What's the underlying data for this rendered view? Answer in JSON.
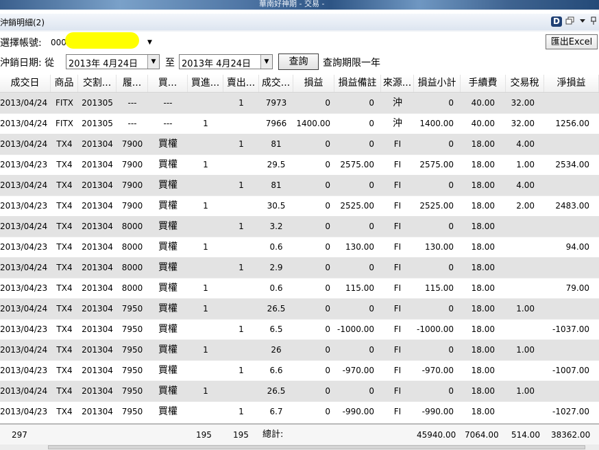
{
  "window": {
    "title_strip": "華南好神期 - 交易 -"
  },
  "panel": {
    "title": "沖銷明細(2)",
    "icons": [
      "d-logo-icon",
      "restore-window-icon",
      "dropdown-arrow-icon",
      "pin-icon"
    ]
  },
  "toolbar": {
    "account_label": "選擇帳號:",
    "account_value": "000",
    "excel_button": "匯出Excel",
    "date_label": "沖銷日期: 從",
    "from_date": "2013年  4月24日",
    "to_label": "至",
    "to_date": "2013年  4月24日",
    "query_button": "查詢",
    "query_note": "查詢期限一年"
  },
  "table": {
    "columns": [
      "成交日",
      "商品",
      "交割...",
      "履...",
      "買...",
      "買進...",
      "賣出...",
      "成交...",
      "損益",
      "損益備註",
      "來源...",
      "損益小計",
      "手續費",
      "交易稅",
      "淨損益"
    ],
    "rows": [
      [
        "2013/04/24",
        "FITX",
        "201305",
        "---",
        "---",
        "",
        "1",
        "7973",
        "0",
        "0",
        "沖",
        "0",
        "40.00",
        "32.00",
        ""
      ],
      [
        "2013/04/24",
        "FITX",
        "201305",
        "---",
        "---",
        "1",
        "",
        "7966",
        "1400.00",
        "0",
        "沖",
        "1400.00",
        "40.00",
        "32.00",
        "1256.00"
      ],
      [
        "2013/04/24",
        "TX4",
        "201304",
        "7900",
        "買權",
        "",
        "1",
        "81",
        "0",
        "0",
        "FI",
        "0",
        "18.00",
        "4.00",
        ""
      ],
      [
        "2013/04/23",
        "TX4",
        "201304",
        "7900",
        "買權",
        "1",
        "",
        "29.5",
        "0",
        "2575.00",
        "FI",
        "2575.00",
        "18.00",
        "1.00",
        "2534.00"
      ],
      [
        "2013/04/24",
        "TX4",
        "201304",
        "7900",
        "買權",
        "",
        "1",
        "81",
        "0",
        "0",
        "FI",
        "0",
        "18.00",
        "4.00",
        ""
      ],
      [
        "2013/04/23",
        "TX4",
        "201304",
        "7900",
        "買權",
        "1",
        "",
        "30.5",
        "0",
        "2525.00",
        "FI",
        "2525.00",
        "18.00",
        "2.00",
        "2483.00"
      ],
      [
        "2013/04/24",
        "TX4",
        "201304",
        "8000",
        "買權",
        "",
        "1",
        "3.2",
        "0",
        "0",
        "FI",
        "0",
        "18.00",
        "",
        ""
      ],
      [
        "2013/04/23",
        "TX4",
        "201304",
        "8000",
        "買權",
        "1",
        "",
        "0.6",
        "0",
        "130.00",
        "FI",
        "130.00",
        "18.00",
        "",
        "94.00"
      ],
      [
        "2013/04/24",
        "TX4",
        "201304",
        "8000",
        "買權",
        "",
        "1",
        "2.9",
        "0",
        "0",
        "FI",
        "0",
        "18.00",
        "",
        ""
      ],
      [
        "2013/04/23",
        "TX4",
        "201304",
        "8000",
        "買權",
        "1",
        "",
        "0.6",
        "0",
        "115.00",
        "FI",
        "115.00",
        "18.00",
        "",
        "79.00"
      ],
      [
        "2013/04/24",
        "TX4",
        "201304",
        "7950",
        "買權",
        "1",
        "",
        "26.5",
        "0",
        "0",
        "FI",
        "0",
        "18.00",
        "1.00",
        ""
      ],
      [
        "2013/04/23",
        "TX4",
        "201304",
        "7950",
        "買權",
        "",
        "1",
        "6.5",
        "0",
        "-1000.00",
        "FI",
        "-1000.00",
        "18.00",
        "",
        "-1037.00"
      ],
      [
        "2013/04/24",
        "TX4",
        "201304",
        "7950",
        "買權",
        "1",
        "",
        "26",
        "0",
        "0",
        "FI",
        "0",
        "18.00",
        "1.00",
        ""
      ],
      [
        "2013/04/23",
        "TX4",
        "201304",
        "7950",
        "買權",
        "",
        "1",
        "6.6",
        "0",
        "-970.00",
        "FI",
        "-970.00",
        "18.00",
        "",
        "-1007.00"
      ],
      [
        "2013/04/24",
        "TX4",
        "201304",
        "7950",
        "買權",
        "1",
        "",
        "26.5",
        "0",
        "0",
        "FI",
        "0",
        "18.00",
        "1.00",
        ""
      ],
      [
        "2013/04/23",
        "TX4",
        "201304",
        "7950",
        "買權",
        "",
        "1",
        "6.7",
        "0",
        "-990.00",
        "FI",
        "-990.00",
        "18.00",
        "",
        "-1027.00"
      ]
    ]
  },
  "footer": {
    "count": "297",
    "buy_total": "195",
    "sell_total": "195",
    "total_label": "總計:",
    "pl_subtotal": "45940.00",
    "fee_total": "7064.00",
    "tax_total": "514.00",
    "net_total": "38362.00"
  },
  "colors": {
    "alt_row": "#e3e3e3",
    "account_mask": "#ffff00",
    "title_blue": "#3a5f8d"
  }
}
